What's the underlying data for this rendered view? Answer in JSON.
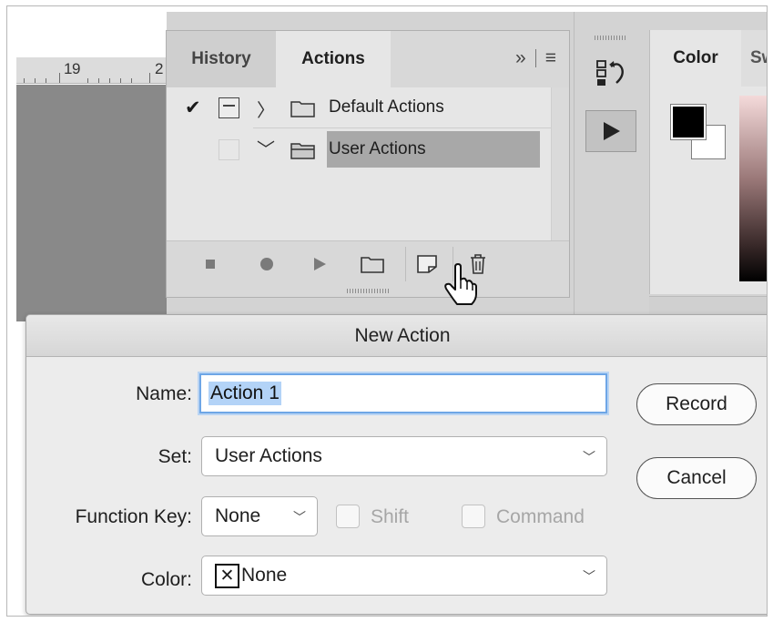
{
  "ruler": {
    "number": "19",
    "number_cut": "2"
  },
  "actions_panel": {
    "tabs": [
      {
        "label": "History",
        "active": false
      },
      {
        "label": "Actions",
        "active": true
      }
    ],
    "expand_glyph": "»",
    "menu_glyph": "≡",
    "rows": [
      {
        "checked": true,
        "expanded": false,
        "label": "Default Actions",
        "selected": false,
        "icon": "folder-icon"
      },
      {
        "checked": false,
        "expanded": true,
        "label": "User Actions",
        "selected": true,
        "icon": "folder-open-icon"
      }
    ],
    "toolbar": [
      "stop-icon",
      "record-icon",
      "play-icon",
      "folder-icon",
      "new-action-icon",
      "trash-icon"
    ]
  },
  "color_panel": {
    "tabs": [
      {
        "label": "Color",
        "active": true
      },
      {
        "label": "Sw",
        "active": false
      }
    ],
    "foreground": "#000000",
    "background": "#ffffff"
  },
  "dialog": {
    "title": "New Action",
    "name_label": "Name:",
    "name_value": "Action 1",
    "set_label": "Set:",
    "set_value": "User Actions",
    "function_key_label": "Function Key:",
    "function_key_value": "None",
    "shift_label": "Shift",
    "command_label": "Command",
    "color_label": "Color:",
    "color_value": "None",
    "color_x": "✕",
    "record_label": "Record",
    "cancel_label": "Cancel"
  },
  "colors": {
    "selection": "#b3d3f7",
    "focus": "#6ea6e6",
    "row_selected": "#a8a8a8"
  }
}
